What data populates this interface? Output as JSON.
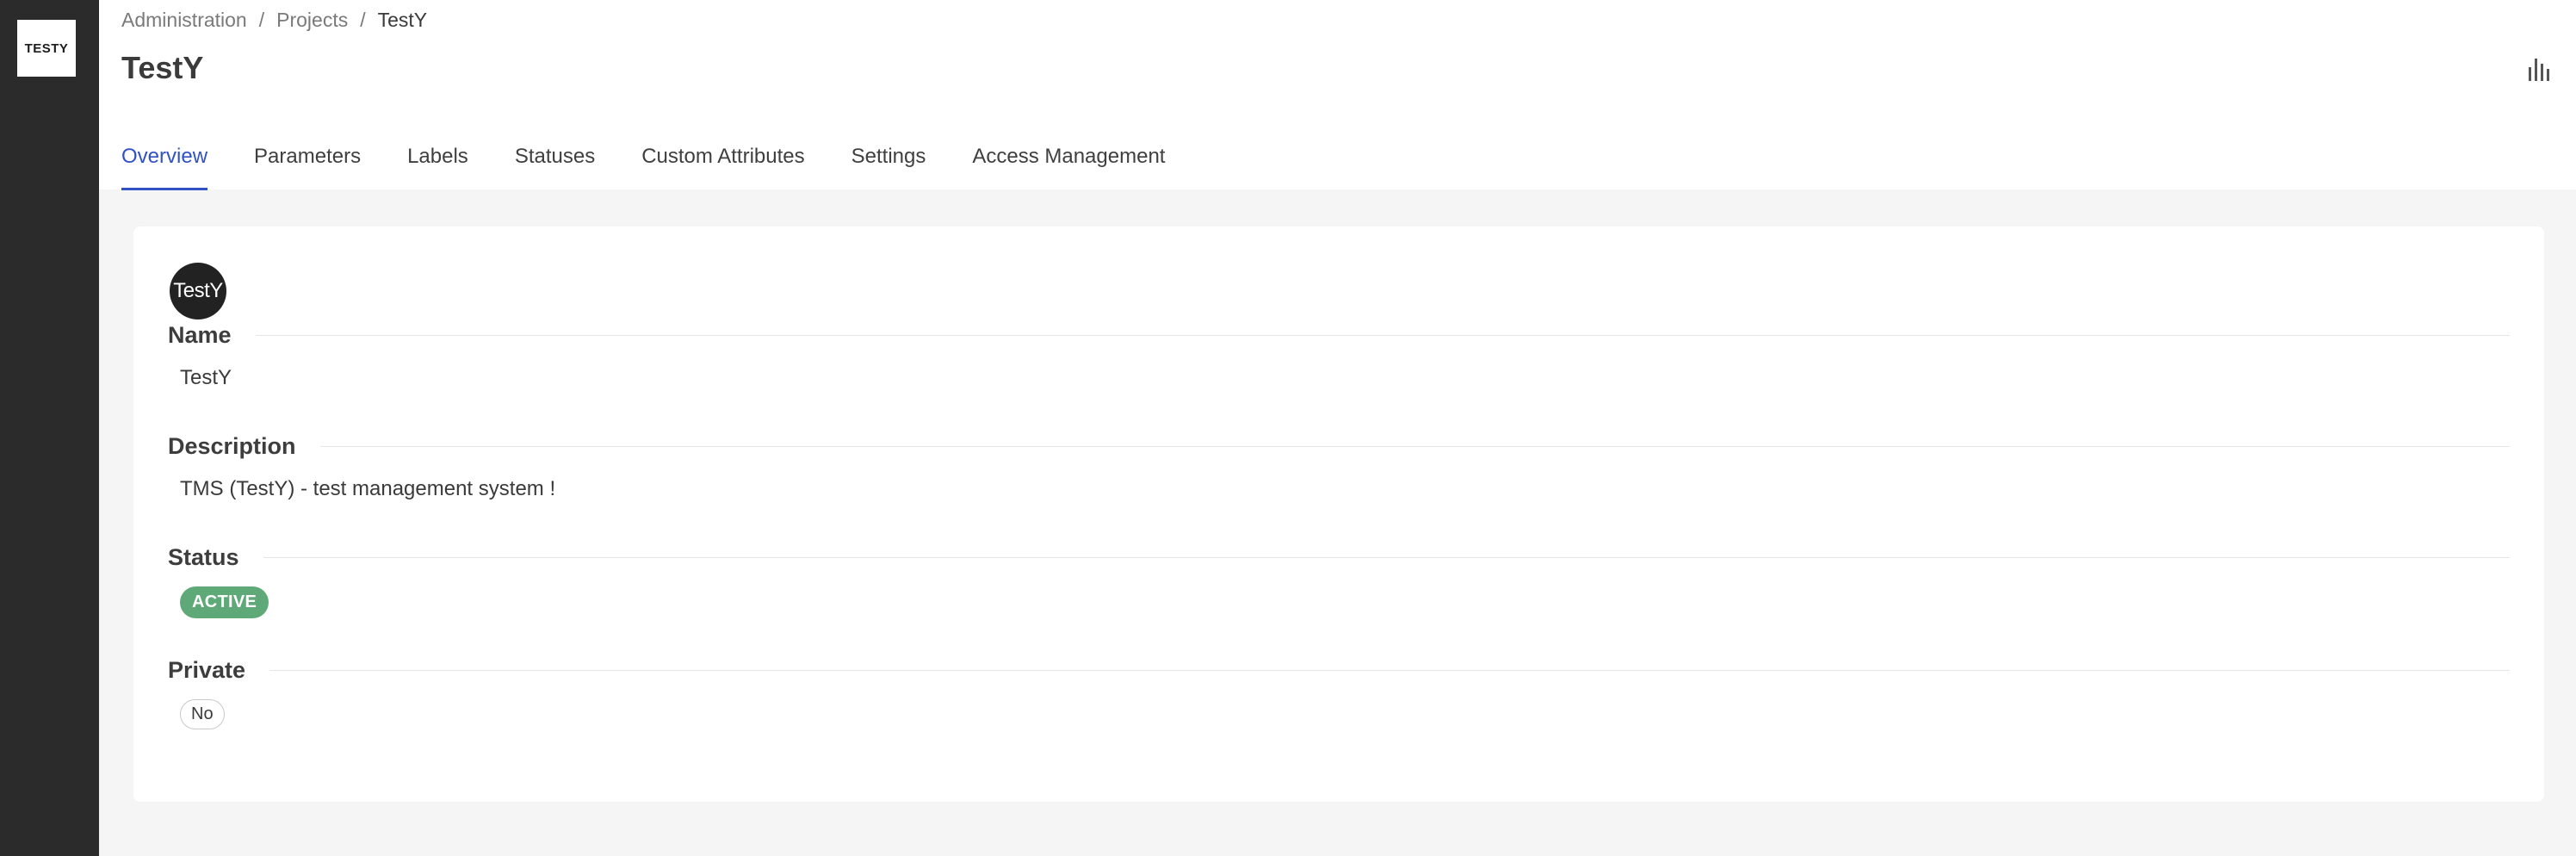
{
  "sidebar": {
    "logo_text": "TESTY"
  },
  "breadcrumb": {
    "items": [
      "Administration",
      "Projects",
      "TestY"
    ],
    "separator": "/"
  },
  "header": {
    "title": "TestY",
    "stats_icon": "bar-chart-icon"
  },
  "tabs": [
    {
      "label": "Overview",
      "active": true
    },
    {
      "label": "Parameters",
      "active": false
    },
    {
      "label": "Labels",
      "active": false
    },
    {
      "label": "Statuses",
      "active": false
    },
    {
      "label": "Custom Attributes",
      "active": false
    },
    {
      "label": "Settings",
      "active": false
    },
    {
      "label": "Access Management",
      "active": false
    }
  ],
  "project": {
    "avatar_text": "TestY",
    "fields": {
      "name_label": "Name",
      "name_value": "TestY",
      "description_label": "Description",
      "description_value": "TMS (TestY) - test management system !",
      "status_label": "Status",
      "status_value": "ACTIVE",
      "private_label": "Private",
      "private_value": "No"
    }
  },
  "colors": {
    "accent": "#3151c5",
    "status_active": "#5fa978",
    "sidebar_bg": "#2b2b2b"
  }
}
